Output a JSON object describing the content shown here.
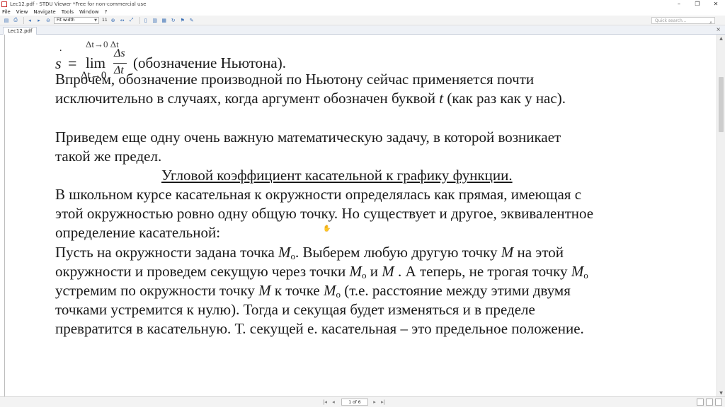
{
  "window": {
    "title": "Lec12.pdf - STDU Viewer *Free for non-commercial use",
    "minimize": "–",
    "maximize": "❐",
    "close": "✕"
  },
  "menu": {
    "file": "File",
    "view": "View",
    "navigate": "Navigate",
    "tools": "Tools",
    "window": "Window",
    "help": "?"
  },
  "toolbar": {
    "zoom_mode": "Fit width",
    "zoom_step": "11",
    "search_placeholder": "Quick search...",
    "icons": [
      "open-icon",
      "print-icon",
      "back-icon",
      "forward-icon",
      "zoom-out-icon",
      "zoom-in-icon",
      "fit-width-icon",
      "fit-page-icon",
      "single-page-icon",
      "continuous-icon",
      "facing-icon",
      "rotate-icon",
      "bookmark-icon",
      "pencil-icon"
    ]
  },
  "tabs": [
    {
      "label": "Lec12.pdf",
      "active": true
    }
  ],
  "tab_close": "×",
  "document": {
    "formula": {
      "cut_top": "Δt→0 Δt",
      "lhs": "s",
      "dot": "˙",
      "eq": "=",
      "lim": "lim",
      "lim_sub": "Δt→0",
      "numerator": "Δs",
      "denominator": "Δt",
      "note": "(обозначение Ньютона)."
    },
    "lines": [
      {
        "text": "Впрочем, обозначение производной по Ньютону сейчас применяется почти"
      },
      {
        "text_before": "исключительно в случаях, когда аргумент обозначен буквой ",
        "italic": "t",
        "text_after": " (как раз как у нас)."
      },
      {
        "text": "Приведем еще одну очень важную математическую задачу, в которой возникает"
      },
      {
        "text": "такой же предел."
      },
      {
        "text": "Угловой коэффициент касательной к графику функции."
      },
      {
        "text": "В школьном курсе касательная к окружности определялась как прямая, имеющая с"
      },
      {
        "text": "этой окружностью ровно одну общую точку. Но существует и другое, эквивалентное"
      },
      {
        "text": "определение касательной:"
      },
      {
        "p1": "Пусть на окружности задана точка ",
        "m1": "M",
        "s1": "o",
        "p2": ". Выберем любую другую точку ",
        "m2": "M",
        "p3": " на этой"
      },
      {
        "p1": "окружности и проведем секущую через точки ",
        "m1": "M",
        "s1": "o",
        "p2": "  и ",
        "m2": "M",
        "p3": " . А теперь, не трогая точку ",
        "m3": "M",
        "s3": "o"
      },
      {
        "p1": "устремим по окружности точку ",
        "m1": "M",
        "p2": " к точке ",
        "m2": "M",
        "s2": "o",
        "p3": " (т.е. расстояние между этими двумя"
      },
      {
        "text": "точками устремится к нулю). Тогда и секущая будет изменяться и в пределе"
      },
      {
        "text": "превратится в касательную. Т. секущей е. касательная – это предельное положение."
      }
    ]
  },
  "status": {
    "page_indicator": "1 of 6"
  }
}
